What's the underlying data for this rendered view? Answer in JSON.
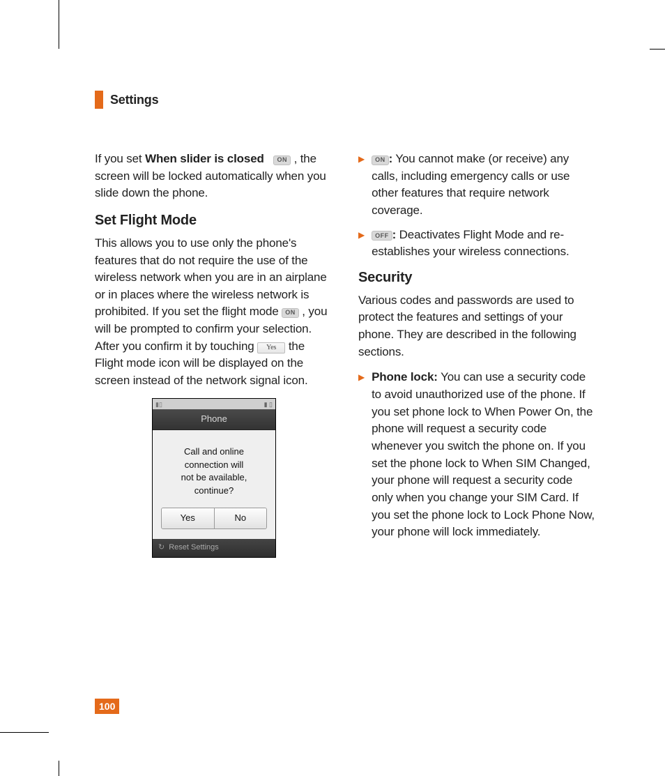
{
  "header": {
    "title": "Settings"
  },
  "pageNumber": "100",
  "badges": {
    "on": "ON",
    "off": "OFF",
    "yes": "Yes"
  },
  "col1": {
    "para1_pre": "If you set ",
    "para1_bold": "When slider is closed",
    "para1_post": ", the screen will be locked automatically when you slide down the phone.",
    "heading": "Set Flight Mode",
    "para2_a": "This allows you to use only the phone's features that do not require the use of the wireless network when you are in an airplane or in places where the wireless network is prohibited. If you set the flight mode ",
    "para2_b": ", you will be prompted to confirm your selection. After you confirm it by touching ",
    "para2_c": " the Flight mode icon will be displayed on the screen instead of the network signal icon."
  },
  "phone": {
    "title": "Phone",
    "line1": "Call and online",
    "line2": "connection will",
    "line3": "not be available,",
    "line4": "continue?",
    "btnYes": "Yes",
    "btnNo": "No",
    "footer": "Reset Settings"
  },
  "col2": {
    "bullet1_suffix": " You cannot make (or receive) any calls, including emergency calls or use other features that require network coverage.",
    "bullet2_suffix": " Deactivates Flight Mode and re-establishes your wireless connections.",
    "heading": "Security",
    "para": "Various codes and passwords are used to protect the features and settings of your phone. They are described in the following sections.",
    "bullet3_bold": "Phone lock:",
    "bullet3_text": " You can use a security code to avoid unauthorized use of the phone. If you set phone lock to When Power On, the phone will request a security code whenever you switch the phone on. If you set the phone lock to When SIM Changed, your phone will request a security code only when you change your SIM Card. If you set the phone lock to Lock Phone Now, your phone will lock immediately.",
    "colon": ":"
  }
}
